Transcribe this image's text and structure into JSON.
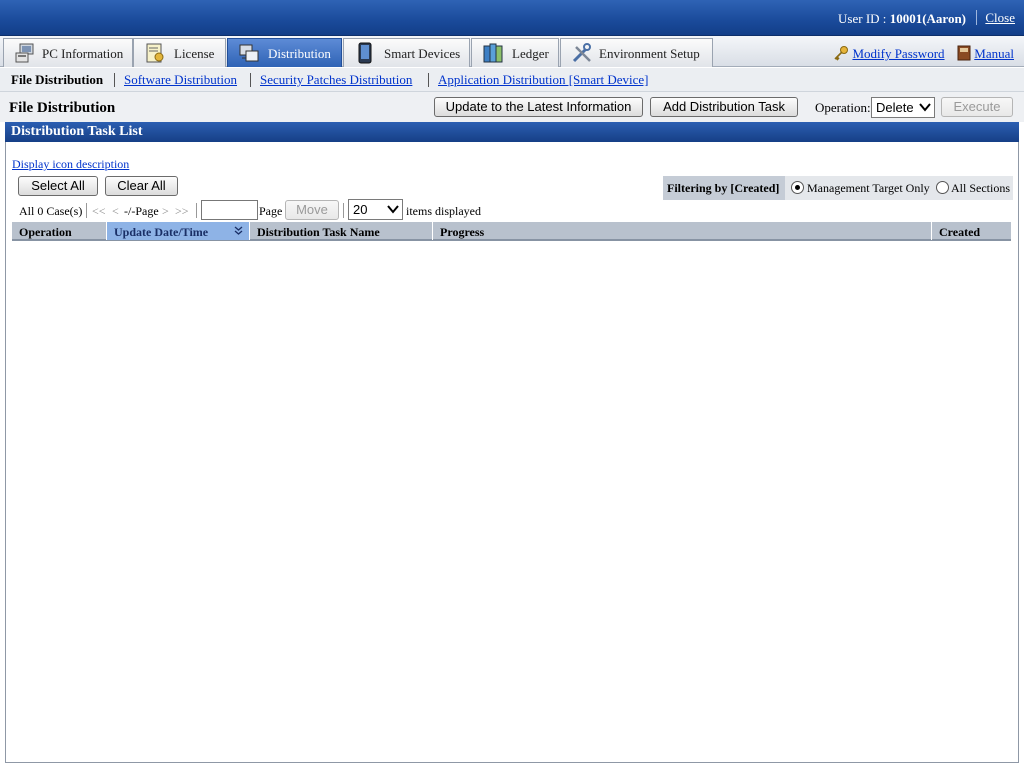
{
  "header": {
    "user_label": "User ID :",
    "user_value": "10001(Aaron)",
    "close": "Close"
  },
  "tabs": [
    {
      "label": "PC Information",
      "icon": "pc-icon"
    },
    {
      "label": "License",
      "icon": "license-icon"
    },
    {
      "label": "Distribution",
      "icon": "distribution-icon",
      "active": true
    },
    {
      "label": "Smart Devices",
      "icon": "smartphone-icon"
    },
    {
      "label": "Ledger",
      "icon": "ledger-icon"
    },
    {
      "label": "Environment Setup",
      "icon": "tools-icon"
    }
  ],
  "right_links": {
    "modify_password": "Modify Password",
    "manual": "Manual"
  },
  "subnav": {
    "current": "File Distribution",
    "software": "Software Distribution",
    "security": "Security Patches Distribution",
    "application": "Application Distribution [Smart Device]"
  },
  "toolbar": {
    "page_title": "File Distribution",
    "update_button": "Update to the Latest Information",
    "add_task_button": "Add Distribution Task",
    "operation_label": "Operation:",
    "operation_value": "Delete",
    "execute_button": "Execute"
  },
  "panel": {
    "title": "Distribution Task List",
    "icon_description_link": "Display icon description",
    "select_all": "Select All",
    "clear_all": "Clear All",
    "filter_label": "Filtering by [Created]",
    "filter_option_1": "Management Target Only",
    "filter_option_2": "All Sections",
    "filter_selected": "Management Target Only"
  },
  "pager": {
    "count": "All 0 Case(s)",
    "first": "<<",
    "prev": "<",
    "page_status": "-/-Page",
    "next": ">",
    "last": ">>",
    "page_label": "Page",
    "move_button": "Move",
    "per_page": "20",
    "items_label": "items displayed"
  },
  "table": {
    "columns": [
      "Operation",
      "Update Date/Time",
      "Distribution Task Name",
      "Progress",
      "Created"
    ],
    "sorted_column": "Update Date/Time",
    "rows": []
  },
  "colors": {
    "header_blue": "#1a4a9a",
    "active_tab": "#2f63b5",
    "link": "#0033cc",
    "sorted_header": "#8eb3e6"
  }
}
